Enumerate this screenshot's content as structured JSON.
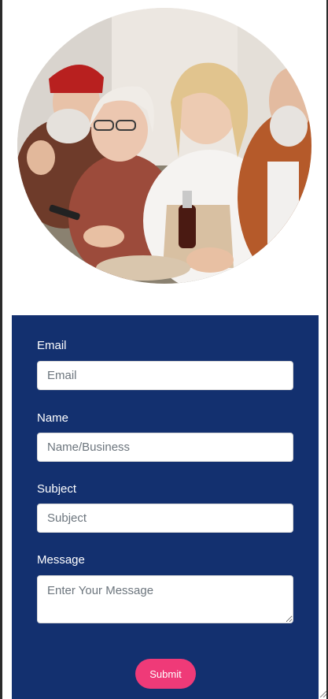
{
  "hero": {
    "image_description_icon": "group-photo-icon"
  },
  "form": {
    "email": {
      "label": "Email",
      "placeholder": "Email"
    },
    "name": {
      "label": "Name",
      "placeholder": "Name/Business"
    },
    "subject": {
      "label": "Subject",
      "placeholder": "Subject"
    },
    "message": {
      "label": "Message",
      "placeholder": "Enter Your Message"
    },
    "submit_label": "Submit"
  },
  "colors": {
    "panel": "#13306f",
    "submit": "#ef3a78"
  }
}
